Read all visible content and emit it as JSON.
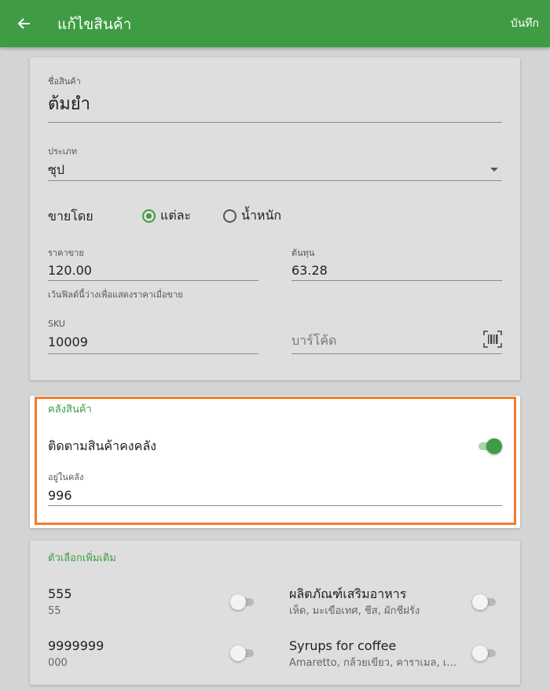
{
  "appbar": {
    "title": "แก้ไขสินค้า",
    "save_label": "บันทึก"
  },
  "product": {
    "name_label": "ชื่อสินค้า",
    "name_value": "ต้มยำ",
    "category_label": "ประเภท",
    "category_value": "ซุป",
    "sell_by_label": "ขายโดย",
    "sell_by_options": [
      {
        "label": "แต่ละ",
        "selected": true
      },
      {
        "label": "น้ำหนัก",
        "selected": false
      }
    ],
    "price_label": "ราคาขาย",
    "price_value": "120.00",
    "price_helper": "เว้นฟิลด์นี้ว่างเพื่อแสดงราคาเมื่อขาย",
    "cost_label": "ต้นทุน",
    "cost_value": "63.28",
    "sku_label": "SKU",
    "sku_value": "10009",
    "barcode_placeholder": "บาร์โค้ด",
    "barcode_icon": "barcode-scan-icon"
  },
  "inventory": {
    "section_title": "คลังสินค้า",
    "track_label": "ติดตามสินค้าคงคลัง",
    "track_enabled": true,
    "stock_label": "อยู่ในคลัง",
    "stock_value": "996"
  },
  "modifiers": {
    "section_title": "ตัวเลือกเพิ่มเติม",
    "items": [
      {
        "title": "555",
        "subtitle": "55",
        "enabled": false
      },
      {
        "title": "ผลิตภัณฑ์เสริมอาหาร",
        "subtitle": "เห็ด, มะเขือเทศ, ชีส, ผักชีฝรั่ง",
        "enabled": false
      },
      {
        "title": "9999999",
        "subtitle": "000",
        "enabled": false
      },
      {
        "title": "Syrups for coffee",
        "subtitle": "Amaretto, กล้วยเขียว, คาราเมล, เก...",
        "enabled": false
      }
    ]
  },
  "colors": {
    "primary": "#3f9c44",
    "highlight": "#f07c2f"
  }
}
